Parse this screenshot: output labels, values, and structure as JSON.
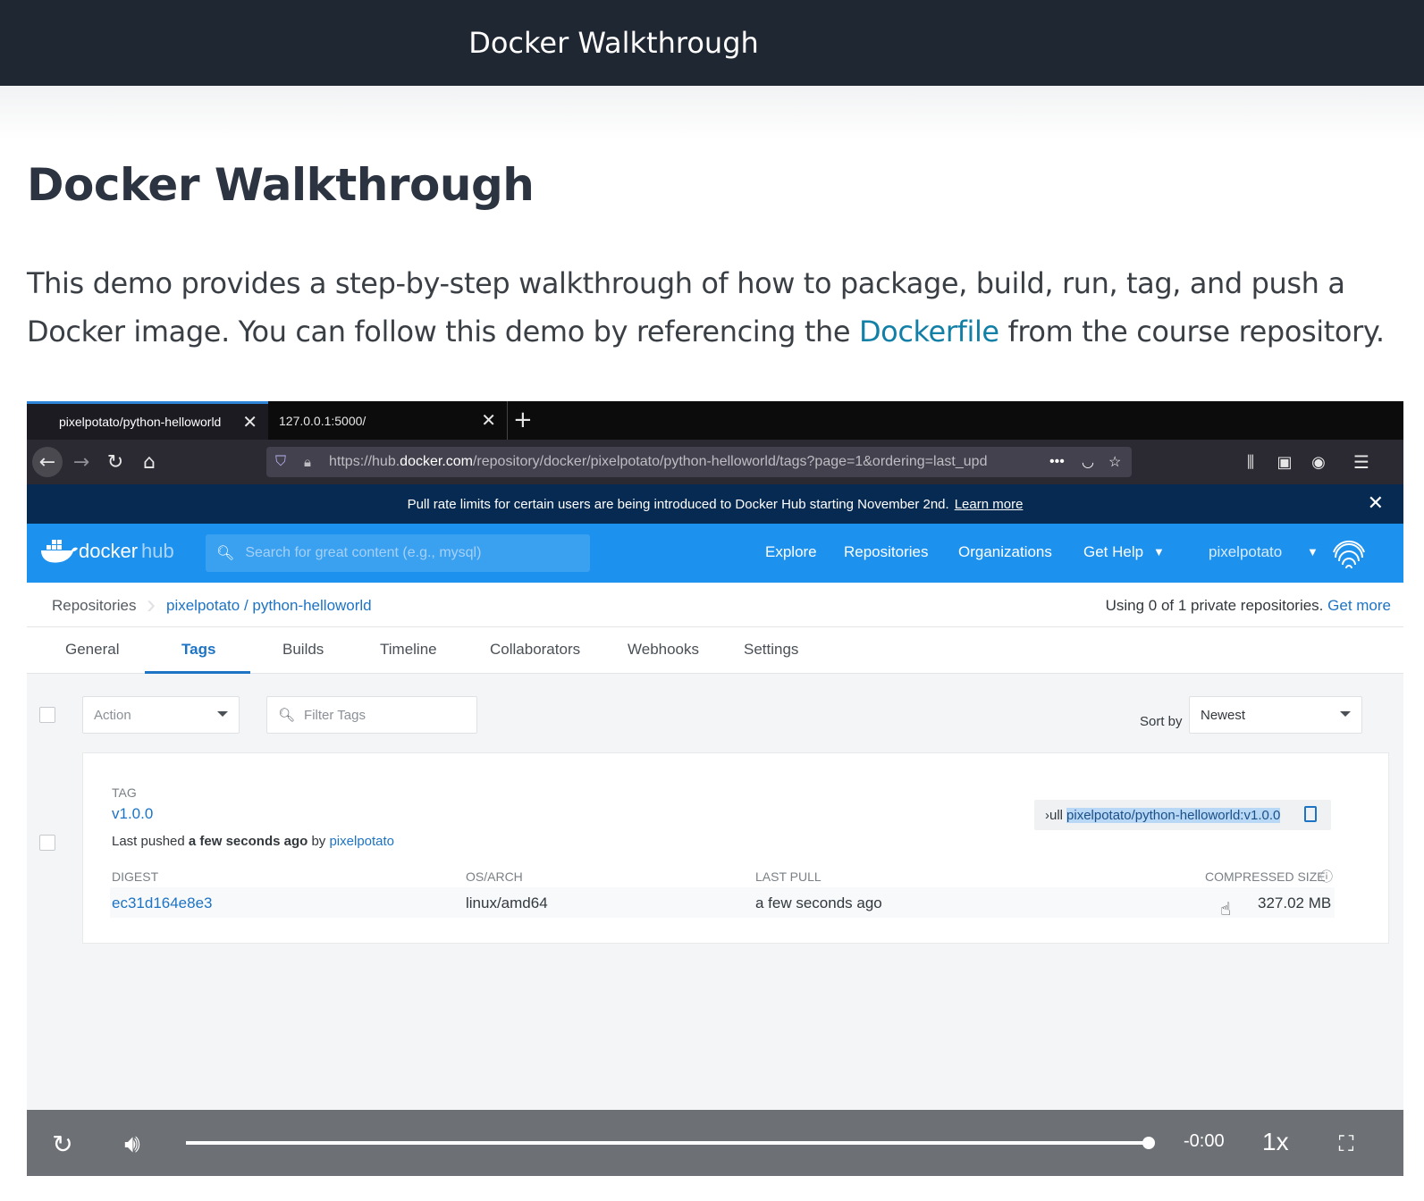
{
  "header": {
    "title": "Docker Walkthrough"
  },
  "article": {
    "title": "Docker Walkthrough",
    "intro_before": "This demo provides a step-by-step walkthrough of how to package, build, run, tag, and push a Docker image. You can follow this demo by referencing the ",
    "intro_link": "Dockerfile",
    "intro_after": " from the course repository."
  },
  "browser": {
    "tabs": [
      {
        "label": "pixelpotato/python-helloworld"
      },
      {
        "label": "127.0.0.1:5000/"
      }
    ],
    "url_prefix": "https://hub.",
    "url_domain": "docker.com",
    "url_path": "/repository/docker/pixelpotato/python-helloworld/tags?page=1&ordering=last_upd"
  },
  "announcement": {
    "text": "Pull rate limits for certain users are being introduced to Docker Hub starting November 2nd.",
    "link": "Learn more"
  },
  "dockerhub_nav": {
    "logo_docker": "docker",
    "logo_hub": "hub",
    "search_placeholder": "Search for great content (e.g., mysql)",
    "links": [
      "Explore",
      "Repositories",
      "Organizations",
      "Get Help"
    ],
    "user": "pixelpotato"
  },
  "breadcrumb": {
    "root": "Repositories",
    "current": "pixelpotato / python-helloworld",
    "private_note": "Using 0 of 1 private repositories.",
    "private_link": "Get more"
  },
  "repo_tabs": [
    "General",
    "Tags",
    "Builds",
    "Timeline",
    "Collaborators",
    "Webhooks",
    "Settings"
  ],
  "toolbar": {
    "action_placeholder": "Action",
    "filter_placeholder": "Filter Tags",
    "sort_label": "Sort by",
    "sort_value": "Newest"
  },
  "tag_card": {
    "tag_label": "TAG",
    "tag": "v1.0.0",
    "pushed_prefix": "Last pushed ",
    "pushed_when": "a few seconds ago",
    "pushed_by": " by ",
    "pushed_user": "pixelpotato",
    "pull_prefix": "›ull",
    "pull_value": "pixelpotato/python-helloworld:v1.0.0",
    "columns": [
      "DIGEST",
      "OS/ARCH",
      "LAST PULL",
      "COMPRESSED SIZE"
    ],
    "digest": "ec31d164e8e3",
    "os_arch": "linux/amd64",
    "last_pull": "a few seconds ago",
    "size": "327.02 MB"
  },
  "player": {
    "time": "-0:00",
    "speed": "1x",
    "progress": 1.0
  },
  "colors": {
    "topbar": "#1f2733",
    "link": "#127fa6",
    "dockerhub_blue": "#1d91ee",
    "announce": "#062a52"
  }
}
